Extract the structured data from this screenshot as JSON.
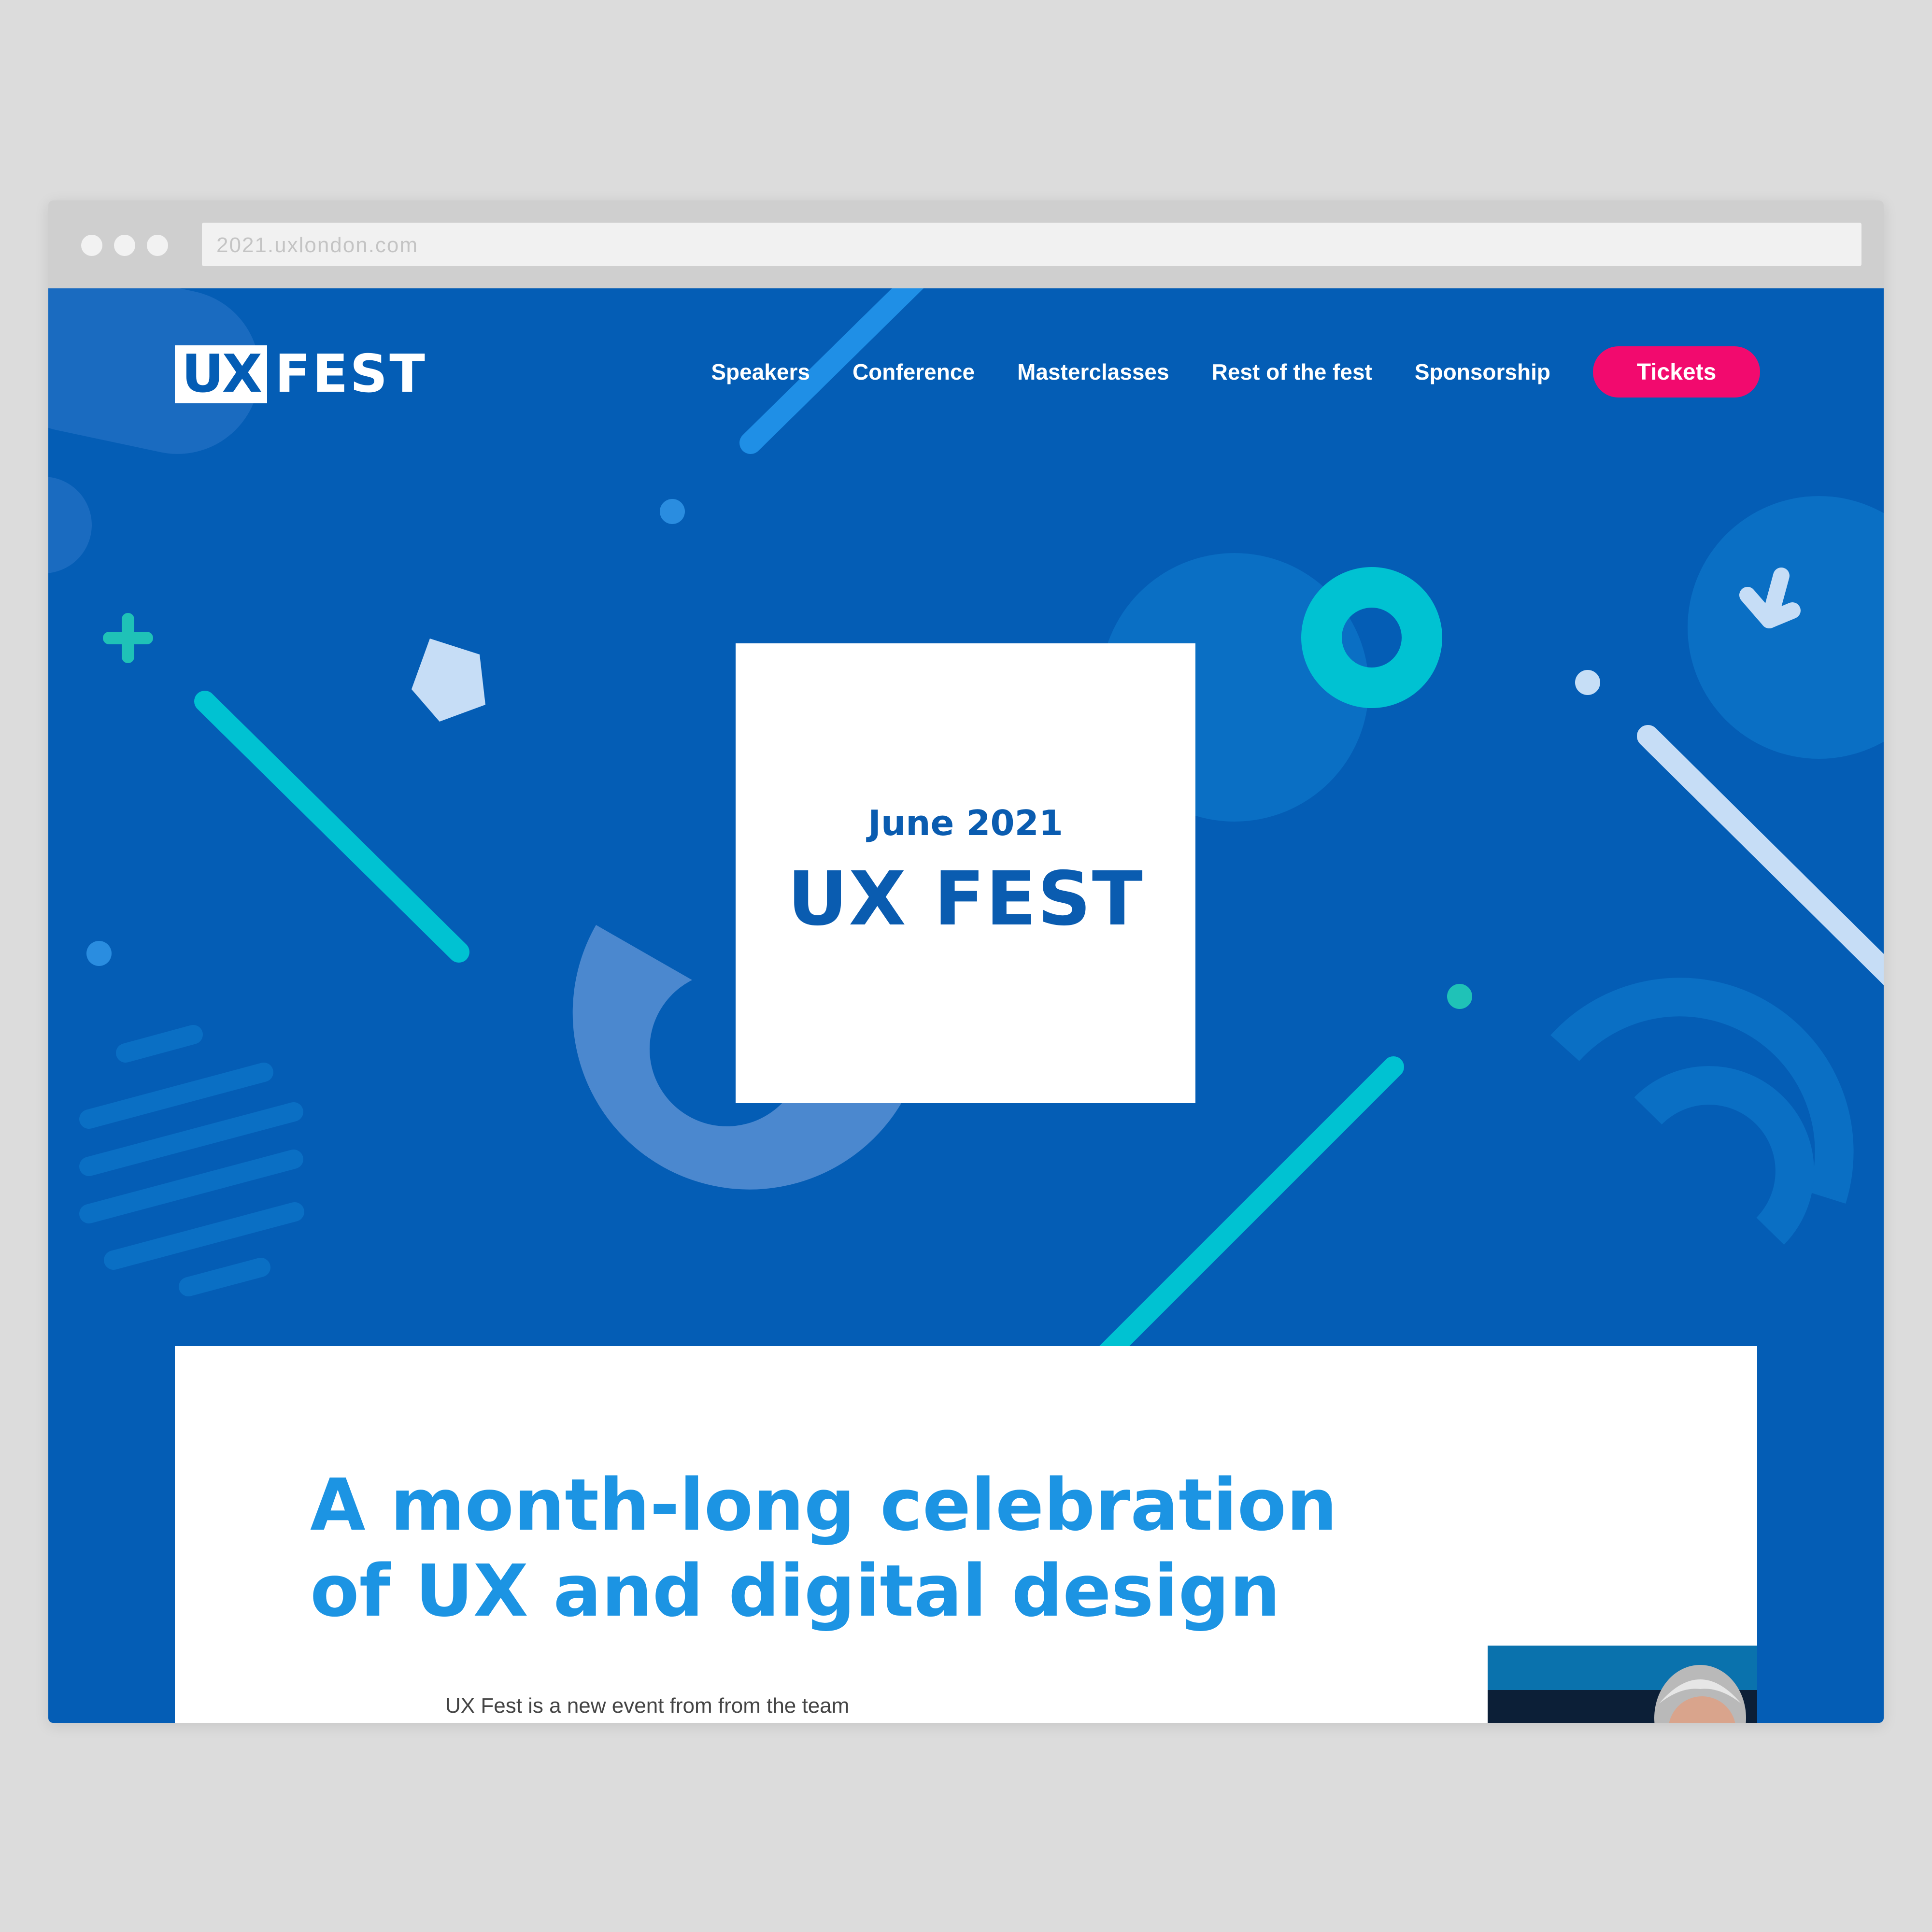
{
  "browser": {
    "url": "2021.uxlondon.com"
  },
  "header": {
    "logo": {
      "part1": "UX",
      "part2": "FEST"
    },
    "nav": [
      {
        "label": "Speakers"
      },
      {
        "label": "Conference"
      },
      {
        "label": "Masterclasses"
      },
      {
        "label": "Rest of the fest"
      },
      {
        "label": "Sponsorship"
      }
    ],
    "cta_label": "Tickets"
  },
  "hero": {
    "date": "June 2021",
    "title": "UX FEST"
  },
  "intro": {
    "headline_line1": "A month-long celebration",
    "headline_line2": "of UX and digital design",
    "body_text": "UX Fest is a new event from from the team"
  },
  "colors": {
    "background_blue": "#045db5",
    "accent_pink": "#f20a6e",
    "accent_teal": "#00c2d2",
    "headline_blue": "#1c94e3"
  }
}
